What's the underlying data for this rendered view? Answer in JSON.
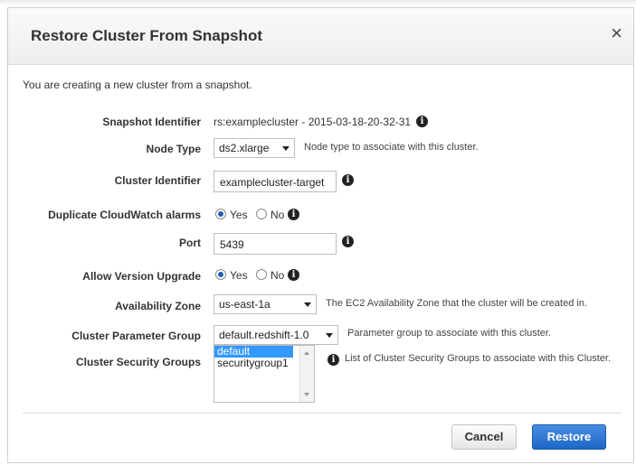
{
  "dialog": {
    "title": "Restore Cluster From Snapshot",
    "close_glyph": "×",
    "intro": "You are creating a new cluster from a snapshot."
  },
  "fields": {
    "snapshot_identifier": {
      "label": "Snapshot Identifier",
      "value": "rs:examplecluster - 2015-03-18-20-32-31"
    },
    "node_type": {
      "label": "Node Type",
      "value": "ds2.xlarge",
      "hint": "Node type to associate with this cluster."
    },
    "cluster_identifier": {
      "label": "Cluster Identifier",
      "value": "examplecluster-target"
    },
    "duplicate_alarms": {
      "label": "Duplicate CloudWatch alarms",
      "yes": "Yes",
      "no": "No",
      "selected": "Yes"
    },
    "port": {
      "label": "Port",
      "value": "5439"
    },
    "allow_version_upgrade": {
      "label": "Allow Version Upgrade",
      "yes": "Yes",
      "no": "No",
      "selected": "Yes"
    },
    "availability_zone": {
      "label": "Availability Zone",
      "value": "us-east-1a",
      "hint": "The EC2 Availability Zone that the cluster will be created in."
    },
    "parameter_group": {
      "label": "Cluster Parameter Group",
      "value": "default.redshift-1.0",
      "hint": "Parameter group to associate with this cluster."
    },
    "security_groups": {
      "label": "Cluster Security Groups",
      "options": [
        "default",
        "securitygroup1"
      ],
      "selected": "default",
      "hint": "List of Cluster Security Groups to associate with this Cluster."
    }
  },
  "buttons": {
    "cancel": "Cancel",
    "restore": "Restore"
  },
  "icons": {
    "info": "info-icon",
    "close": "close-icon"
  },
  "colors": {
    "primary_button": "#1e66c8",
    "selection": "#3399ff"
  }
}
